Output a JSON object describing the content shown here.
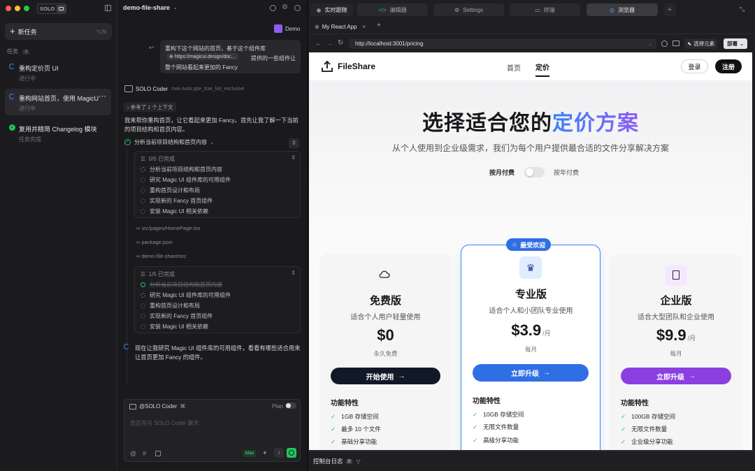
{
  "window": {
    "app_badge": "SOLO",
    "project": "demo-file-share"
  },
  "sidebar": {
    "new_task": "新任务",
    "new_task_shortcut": "⌥N",
    "tasks_label": "任务",
    "tasks_count": "3",
    "tasks": [
      {
        "title": "重构定价页 UI",
        "status": "进行中"
      },
      {
        "title": "重构网站首页，使用 MagicU...",
        "status": "进行中"
      },
      {
        "title": "复用并精简 Changelog 模块",
        "status": "任务完成"
      }
    ]
  },
  "chat": {
    "user_name": "Demo",
    "user_msg": "重构下这个网站的首页，基于这个组件库",
    "user_link": "https://magicui.design/doc...",
    "user_msg_cont": "提供的一些组件让整个网站看起来更加的 Fancy",
    "agent_name": "SOLO Coder",
    "agent_meta": "max Auto ppe_trae_kol_exclusive",
    "context_ref": "参考了 1 个上下文",
    "agent_msg": "我来帮你重构首页，让它看起来更加 Fancy。首先让我了解一下当前的项目结构和首页内容。",
    "step_title": "分析当前项目结构和首页内容",
    "todo1_header": "0/5 已完成",
    "todo2_header": "1/5 已完成",
    "todo_items": [
      "分析当前项目结构和首页内容",
      "研究 Magic UI 组件库的可用组件",
      "重构首页设计和布局",
      "实现新的 Fancy 首页组件",
      "安装 Magic UI 相关依赖"
    ],
    "files": [
      "src/pages/HomePage.tsx",
      "package.json",
      "demo-file-share/src"
    ],
    "agent_msg2": "现在让我研究 Magic UI 组件库的可用组件，看看有哪些适合用来让首页更加 Fancy 的组件。",
    "input_agent": "@SOLO Coder",
    "input_plan": "Plan",
    "input_placeholder": "您正在与 SOLO Coder 聊天",
    "input_max": "Max"
  },
  "right_tabs": [
    "实时跟随",
    "编辑器",
    "Settings",
    "终端",
    "浏览器"
  ],
  "browser": {
    "tab_title": "My React App",
    "url": "http://localhost:3001/pricing",
    "select_element": "选择元素",
    "deploy": "部署"
  },
  "site": {
    "logo": "FileShare",
    "nav": [
      "首页",
      "定价"
    ],
    "login": "登录",
    "register": "注册",
    "hero_title_a": "选择适合您的",
    "hero_title_b": "定价方案",
    "hero_sub": "从个人使用到企业级需求，我们为每个用户提供最合适的文件分享解决方案",
    "toggle_monthly": "按月付费",
    "toggle_yearly": "按年付费",
    "popular_badge": "最受欢迎",
    "features_label": "功能特性",
    "plans": [
      {
        "name": "免费版",
        "desc": "适合个人用户轻量使用",
        "price": "$0",
        "unit": "",
        "period": "永久免费",
        "cta": "开始使用",
        "features": [
          "1GB 存储空间",
          "最多 10 个文件",
          "基础分享功能"
        ]
      },
      {
        "name": "专业版",
        "desc": "适合个人和小团队专业使用",
        "price": "$3.9",
        "unit": "/月",
        "period": "每月",
        "cta": "立即升级",
        "features": [
          "10GB 存储空间",
          "无限文件数量",
          "高级分享功能"
        ]
      },
      {
        "name": "企业版",
        "desc": "适合大型团队和企业使用",
        "price": "$9.9",
        "unit": "/月",
        "period": "每月",
        "cta": "立即升级",
        "features": [
          "100GB 存储空间",
          "无限文件数量",
          "企业级分享功能"
        ]
      }
    ]
  },
  "console": {
    "label": "控制台日志",
    "count": "0"
  },
  "colors": {
    "accent_blue": "#2f6fe4",
    "accent_purple": "#8b3fe0",
    "dark_btn": "#111827",
    "hero_gradient_start": "#3b82f6",
    "hero_gradient_end": "#8b5cf6"
  }
}
